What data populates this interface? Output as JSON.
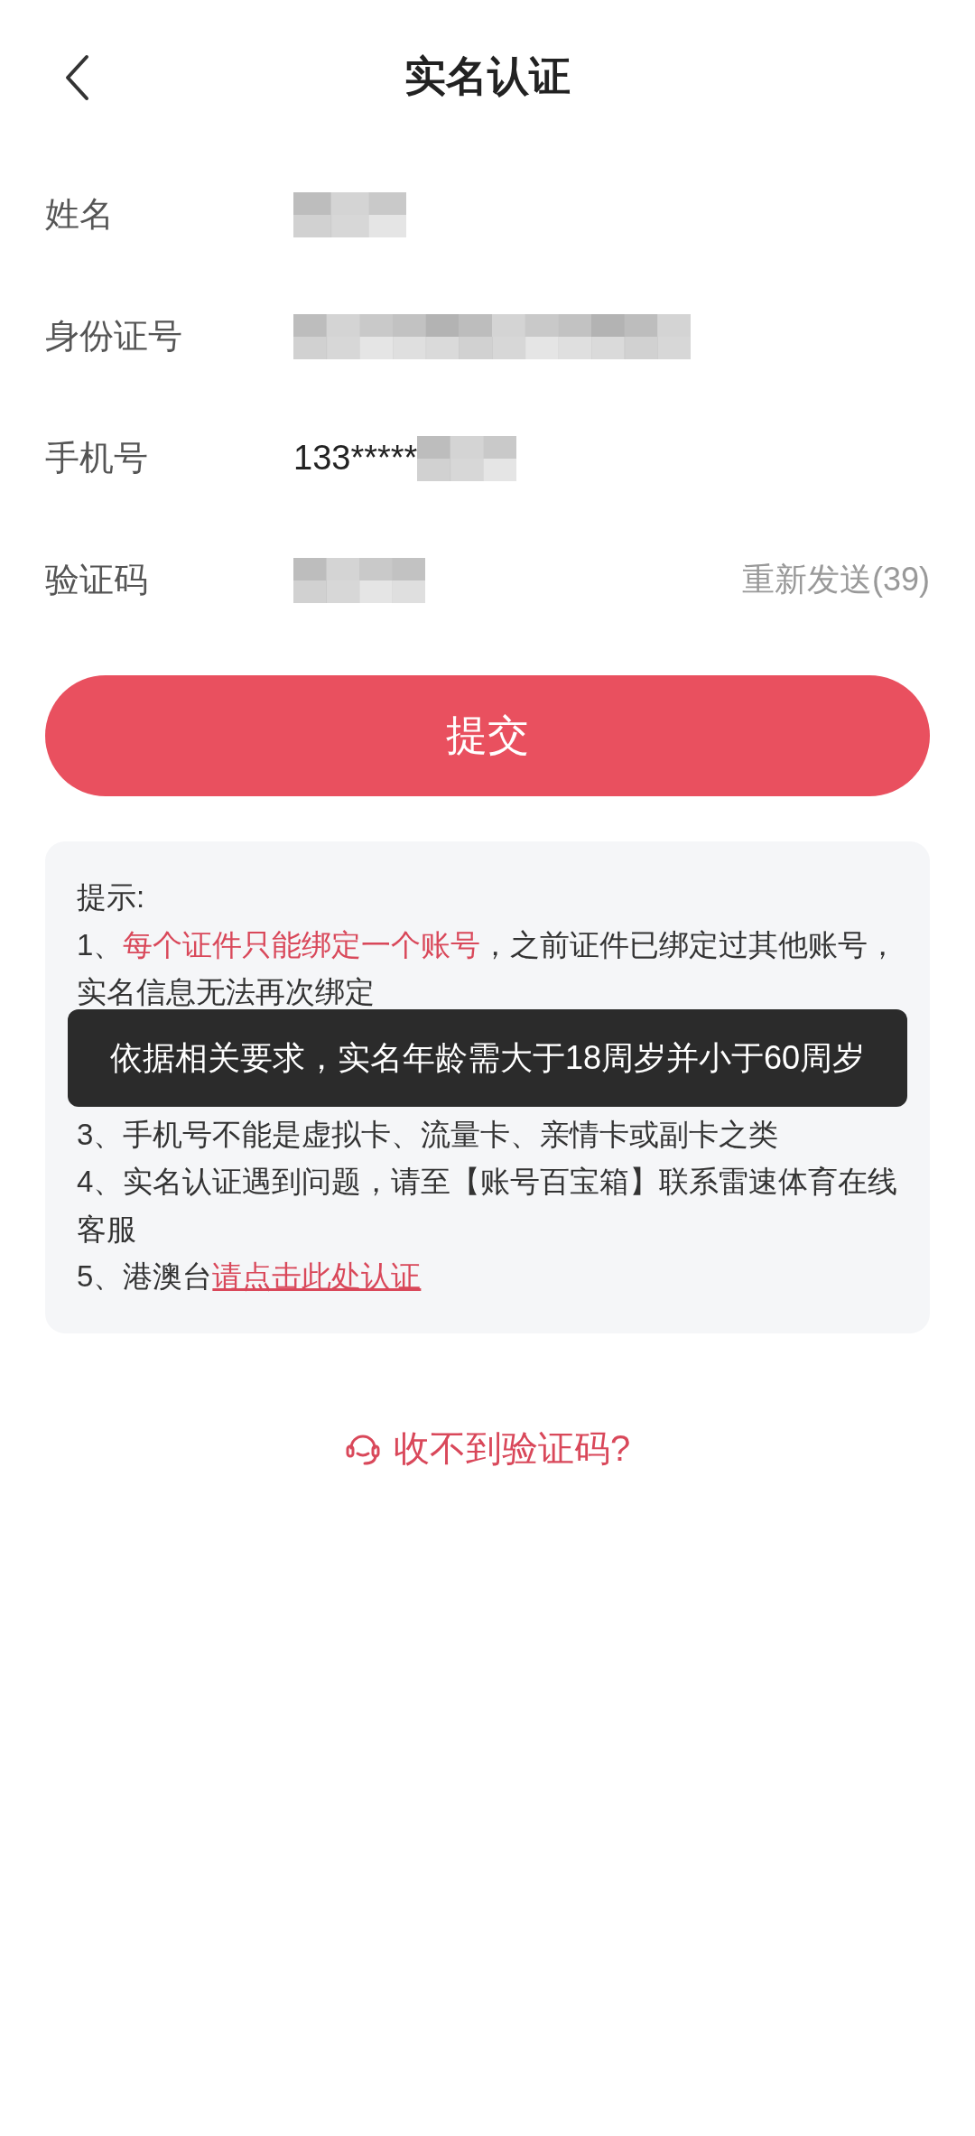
{
  "header": {
    "title": "实名认证"
  },
  "fields": [
    {
      "label": "姓名",
      "redacted": true
    },
    {
      "label": "身份证号",
      "redacted": true
    },
    {
      "label": "手机号",
      "value": "133*****",
      "redacted": true
    },
    {
      "label": "验证码",
      "redacted": true,
      "resend": {
        "label": "重新发送(39)",
        "disabled": true
      }
    }
  ],
  "submit_button": {
    "label": "提交"
  },
  "tips": {
    "title": "提示:",
    "items": [
      {
        "segments": [
          {
            "kind": "plain",
            "text": "1、"
          },
          {
            "kind": "highlight",
            "text": "每个证件只能绑定一个账号"
          },
          {
            "kind": "plain",
            "text": "，之前证件已绑定过其他账号，实名信息无法再次绑定"
          }
        ]
      },
      {
        "kind": "covered"
      },
      {
        "segments": [
          {
            "kind": "plain",
            "text": "3、手机号不能是虚拟卡、流量卡、亲情卡或副卡之类"
          }
        ]
      },
      {
        "segments": [
          {
            "kind": "plain",
            "text": "4、实名认证遇到问题，请至【账号百宝箱】联系雷速体育在线客服"
          }
        ]
      },
      {
        "segments": [
          {
            "kind": "plain",
            "text": "5、港澳台"
          },
          {
            "kind": "link",
            "text": "请点击此处认证"
          }
        ]
      }
    ]
  },
  "toast": {
    "message": "依据相关要求，实名年龄需大于18周岁并小于60周岁"
  },
  "help_link": {
    "label": "收不到验证码?"
  }
}
